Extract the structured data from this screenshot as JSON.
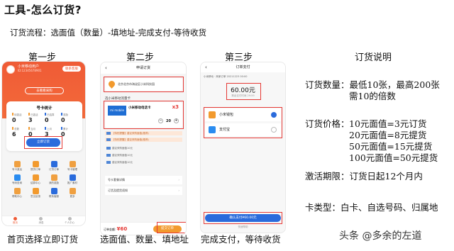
{
  "title": "工具-怎么订货?",
  "flow_text": "订货流程：选面值（数量）-填地址-完成支付-等待收货",
  "steps": {
    "step1": "第一步",
    "step2": "第二步",
    "step3": "第三步",
    "explain_heading": "订货说明"
  },
  "captions": {
    "step1": "首页选择立即订货",
    "step2": "选面值、数量、填地址",
    "step3": "完成支付，等待收货"
  },
  "phone1": {
    "user_name": "小米移动用户",
    "user_sub": "ID:12345678901",
    "service_label": "联系客服",
    "top_button": "去看看采购",
    "card_title": "号卡统计",
    "stats": [
      {
        "label": "待激活",
        "value": "0",
        "color": "#f29a2e"
      },
      {
        "label": "已激活",
        "value": "3",
        "color": "#f29a2e"
      },
      {
        "label": "已结算",
        "value": "0",
        "color": "#2a6bdc"
      },
      {
        "label": "奖励",
        "value": "0",
        "color": "#2a6bdc"
      },
      {
        "label": "总数",
        "value": "6",
        "color": "#f29a2e"
      },
      {
        "label": "当月",
        "value": "0",
        "color": "#f29a2e"
      },
      {
        "label": "上月",
        "value": "3",
        "color": "#2a6bdc"
      },
      {
        "label": "累计",
        "value": "0",
        "color": "#2a6bdc"
      }
    ],
    "order_button": "立即订货",
    "icons": [
      "号卡激活",
      "提货订单",
      "订货订单",
      "号卡管理",
      "号码查询",
      "结算中心",
      "我的奖励",
      "推广素材",
      "帮助中心",
      "意见反馈",
      "联系客服",
      "更多"
    ],
    "tabs": [
      "首页",
      "消息",
      "个人中心"
    ]
  },
  "phone2": {
    "header": "申请订货",
    "address": "北京北京市海淀区小米科技园",
    "section_label": "选小米移动流量卡",
    "card_image_text": "mi mobile",
    "product_name": "小米移动电话卡",
    "product_multiplier": "x3",
    "quantity": "20",
    "notes": [
      "【特别提醒】建议采购面值(推荐)",
      "【特别提醒】建议采购面值(推荐)",
      "建议采购面值10元",
      "建议采购面值10元",
      "建议采购面值10元"
    ],
    "rows": [
      "号卡套餐详情",
      "订货及提货须知"
    ],
    "total_label": "订单金额:",
    "total_value": "¥60",
    "submit_button": "提交订单"
  },
  "phone3": {
    "header": "订单支付",
    "info": "小米移动 · 商家订单 20211223 00:00",
    "price": "60.00元",
    "price_sub": "剩余支付时间 29:59",
    "methods": [
      {
        "name": "小米钱包",
        "selected": true,
        "color": "#f29a2e"
      },
      {
        "name": "支付宝",
        "selected": false,
        "color": "#2a8cf0"
      }
    ],
    "confirm_button": "确认支付¥60.00元",
    "footer": "快速帮助"
  },
  "explanation": {
    "quantity_label": "订货数量：",
    "quantity_line1": "最低10张，最高200张",
    "quantity_line2": "需10的倍数",
    "price_label": "订货价格：",
    "price_lines": [
      "10元面值=3元订货",
      "20元面值=8元提货",
      "50元面值=15元提货",
      "100元面值=50元提货"
    ],
    "activation": "激活期限：订货日起12个月内",
    "card_type": "卡类型：白卡、自选号码、归属地"
  },
  "watermark": "头条 @多余的左道"
}
